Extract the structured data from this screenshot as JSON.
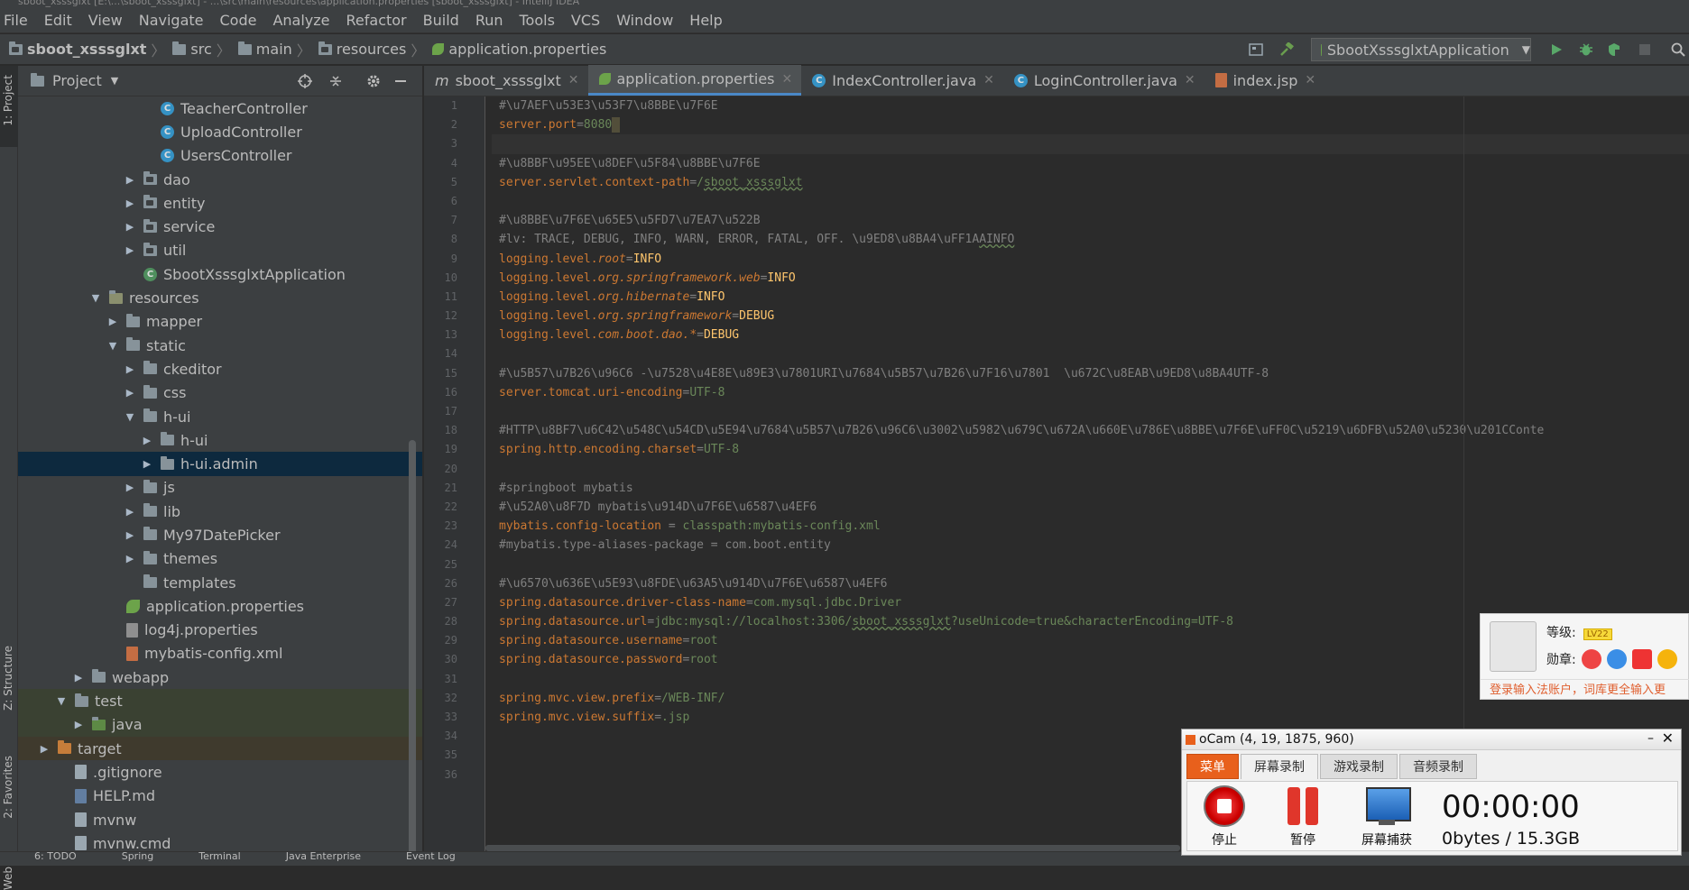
{
  "window_title": "sboot_xsssglxt [E:\\...\\sboot_xsssglxt] - ...\\src\\main\\resources\\application.properties [sboot_xsssglxt] - IntelliJ IDEA",
  "menu": [
    "File",
    "Edit",
    "View",
    "Navigate",
    "Code",
    "Analyze",
    "Refactor",
    "Build",
    "Run",
    "Tools",
    "VCS",
    "Window",
    "Help"
  ],
  "breadcrumb": [
    "sboot_xsssglxt",
    "src",
    "main",
    "resources",
    "application.properties"
  ],
  "run_config": "SbootXsssglxtApplication",
  "project_panel": {
    "title": "Project"
  },
  "left_strip": {
    "project": "1: Project",
    "structure": "Z: Structure",
    "favorites": "2: Favorites",
    "web": "Web"
  },
  "tree": [
    {
      "label": "TeacherController",
      "indent": 7,
      "icon": "class",
      "arrow": ""
    },
    {
      "label": "UploadController",
      "indent": 7,
      "icon": "class",
      "arrow": ""
    },
    {
      "label": "UsersController",
      "indent": 7,
      "icon": "class",
      "arrow": ""
    },
    {
      "label": "dao",
      "indent": 6,
      "icon": "package",
      "arrow": "▶"
    },
    {
      "label": "entity",
      "indent": 6,
      "icon": "package",
      "arrow": "▶"
    },
    {
      "label": "service",
      "indent": 6,
      "icon": "package",
      "arrow": "▶"
    },
    {
      "label": "util",
      "indent": 6,
      "icon": "package",
      "arrow": "▶"
    },
    {
      "label": "SbootXsssglxtApplication",
      "indent": 6,
      "icon": "spring-class",
      "arrow": ""
    },
    {
      "label": "resources",
      "indent": 4,
      "icon": "resources-folder",
      "arrow": "▼"
    },
    {
      "label": "mapper",
      "indent": 5,
      "icon": "folder",
      "arrow": "▶"
    },
    {
      "label": "static",
      "indent": 5,
      "icon": "folder",
      "arrow": "▼"
    },
    {
      "label": "ckeditor",
      "indent": 6,
      "icon": "folder",
      "arrow": "▶"
    },
    {
      "label": "css",
      "indent": 6,
      "icon": "folder",
      "arrow": "▶"
    },
    {
      "label": "h-ui",
      "indent": 6,
      "icon": "folder",
      "arrow": "▼"
    },
    {
      "label": "h-ui",
      "indent": 7,
      "icon": "folder",
      "arrow": "▶"
    },
    {
      "label": "h-ui.admin",
      "indent": 7,
      "icon": "folder",
      "arrow": "▶",
      "selected": true
    },
    {
      "label": "js",
      "indent": 6,
      "icon": "folder",
      "arrow": "▶"
    },
    {
      "label": "lib",
      "indent": 6,
      "icon": "folder",
      "arrow": "▶"
    },
    {
      "label": "My97DatePicker",
      "indent": 6,
      "icon": "folder",
      "arrow": "▶"
    },
    {
      "label": "themes",
      "indent": 6,
      "icon": "folder",
      "arrow": "▶"
    },
    {
      "label": "templates",
      "indent": 6,
      "icon": "folder",
      "arrow": ""
    },
    {
      "label": "application.properties",
      "indent": 5,
      "icon": "spring-properties",
      "arrow": ""
    },
    {
      "label": "log4j.properties",
      "indent": 5,
      "icon": "properties-file",
      "arrow": ""
    },
    {
      "label": "mybatis-config.xml",
      "indent": 5,
      "icon": "xml-file",
      "arrow": ""
    },
    {
      "label": "webapp",
      "indent": 3,
      "icon": "folder",
      "arrow": "▶"
    },
    {
      "label": "test",
      "indent": 2,
      "icon": "folder",
      "arrow": "▼",
      "bg": "test"
    },
    {
      "label": "java",
      "indent": 3,
      "icon": "test-folder",
      "arrow": "▶",
      "bg": "test"
    },
    {
      "label": "target",
      "indent": 1,
      "icon": "orange-folder",
      "arrow": "▶",
      "bg": "target"
    },
    {
      "label": ".gitignore",
      "indent": 2,
      "icon": "text-file",
      "arrow": ""
    },
    {
      "label": "HELP.md",
      "indent": 2,
      "icon": "md-file",
      "arrow": ""
    },
    {
      "label": "mvnw",
      "indent": 2,
      "icon": "text-file",
      "arrow": ""
    },
    {
      "label": "mvnw.cmd",
      "indent": 2,
      "icon": "text-file",
      "arrow": ""
    }
  ],
  "tabs": [
    {
      "label": "sboot_xsssglxt",
      "icon": "maven-icon",
      "active": false
    },
    {
      "label": "application.properties",
      "icon": "spring-properties-icon",
      "active": true
    },
    {
      "label": "IndexController.java",
      "icon": "class-icon",
      "active": false
    },
    {
      "label": "LoginController.java",
      "icon": "class-icon",
      "active": false
    },
    {
      "label": "index.jsp",
      "icon": "jsp-icon",
      "active": false
    }
  ],
  "code_lines": [
    [
      [
        "c",
        "#\\u7AEF\\u53E3\\u53F7\\u8BBE\\u7F6E"
      ]
    ],
    [
      [
        "k",
        "server.port"
      ],
      [
        "eq",
        "="
      ],
      [
        "v",
        "8080"
      ],
      [
        "caret",
        ""
      ]
    ],
    [],
    [
      [
        "c",
        "#\\u8BBF\\u95EE\\u8DEF\\u5F84\\u8BBE\\u7F6E"
      ]
    ],
    [
      [
        "k",
        "server.servlet.context-path"
      ],
      [
        "eq",
        "="
      ],
      [
        "v",
        "/"
      ],
      [
        "vu",
        "sboot_xsssglxt"
      ]
    ],
    [],
    [
      [
        "c",
        "#\\u8BBE\\u7F6E\\u65E5\\u5FD7\\u7EA7\\u522B"
      ]
    ],
    [
      [
        "c",
        "#lv: TRACE, DEBUG, INFO, WARN, ERROR, FATAL, OFF. \\u9ED8\\u8BA4\\uFF1A"
      ],
      [
        "cu",
        "AINFO"
      ]
    ],
    [
      [
        "k",
        "logging.level."
      ],
      [
        "ki",
        "root"
      ],
      [
        "eq",
        "="
      ],
      [
        "y",
        "INFO"
      ]
    ],
    [
      [
        "k",
        "logging.level."
      ],
      [
        "ki",
        "org.springframework.web"
      ],
      [
        "eq",
        "="
      ],
      [
        "y",
        "INFO"
      ]
    ],
    [
      [
        "k",
        "logging.level."
      ],
      [
        "ki",
        "org.hibernate"
      ],
      [
        "eq",
        "="
      ],
      [
        "y",
        "INFO"
      ]
    ],
    [
      [
        "k",
        "logging.level."
      ],
      [
        "ki",
        "org.springframework"
      ],
      [
        "eq",
        "="
      ],
      [
        "y",
        "DEBUG"
      ]
    ],
    [
      [
        "k",
        "logging.level."
      ],
      [
        "ki",
        "com.boot.dao.*"
      ],
      [
        "eq",
        "="
      ],
      [
        "y",
        "DEBUG"
      ]
    ],
    [],
    [
      [
        "c",
        "#\\u5B57\\u7B26\\u96C6 -\\u7528\\u4E8E\\u89E3\\u7801URI\\u7684\\u5B57\\u7B26\\u7F16\\u7801  \\u672C\\u8EAB\\u9ED8\\u8BA4UTF-8"
      ]
    ],
    [
      [
        "k",
        "server.tomcat.uri-encoding"
      ],
      [
        "eq",
        "="
      ],
      [
        "v",
        "UTF-8"
      ]
    ],
    [],
    [
      [
        "c",
        "#HTTP\\u8BF7\\u6C42\\u548C\\u54CD\\u5E94\\u7684\\u5B57\\u7B26\\u96C6\\u3002\\u5982\\u679C\\u672A\\u660E\\u786E\\u8BBE\\u7F6E\\uFF0C\\u5219\\u6DFB\\u52A0\\u5230\\u201CConte"
      ]
    ],
    [
      [
        "k",
        "spring.http.encoding.charset"
      ],
      [
        "eq",
        "="
      ],
      [
        "v",
        "UTF-8"
      ]
    ],
    [],
    [
      [
        "c",
        "#springboot mybatis"
      ]
    ],
    [
      [
        "c",
        "#\\u52A0\\u8F7D mybatis\\u914D\\u7F6E\\u6587\\u4EF6"
      ]
    ],
    [
      [
        "k",
        "mybatis.config-location"
      ],
      [
        "eq",
        " = "
      ],
      [
        "v",
        "classpath:mybatis-config.xml"
      ]
    ],
    [
      [
        "c",
        "#mybatis.type-aliases-package = com.boot.entity"
      ]
    ],
    [],
    [
      [
        "c",
        "#\\u6570\\u636E\\u5E93\\u8FDE\\u63A5\\u914D\\u7F6E\\u6587\\u4EF6"
      ]
    ],
    [
      [
        "k",
        "spring.datasource.driver-class-name"
      ],
      [
        "eq",
        "="
      ],
      [
        "v",
        "com.mysql.jdbc.Driver"
      ]
    ],
    [
      [
        "k",
        "spring.datasource.url"
      ],
      [
        "eq",
        "="
      ],
      [
        "v",
        "jdbc:mysql://localhost:3306/"
      ],
      [
        "vu",
        "sboot_xsssglxt"
      ],
      [
        "v",
        "?useUnicode=true&characterEncoding=UTF-8"
      ]
    ],
    [
      [
        "k",
        "spring.datasource.username"
      ],
      [
        "eq",
        "="
      ],
      [
        "v",
        "root"
      ]
    ],
    [
      [
        "k",
        "spring.datasource.password"
      ],
      [
        "eq",
        "="
      ],
      [
        "v",
        "root"
      ]
    ],
    [],
    [
      [
        "k",
        "spring.mvc.view.prefix"
      ],
      [
        "eq",
        "="
      ],
      [
        "v",
        "/WEB-INF/"
      ]
    ],
    [
      [
        "k",
        "spring.mvc.view.suffix"
      ],
      [
        "eq",
        "="
      ],
      [
        "v",
        ".jsp"
      ]
    ],
    [],
    [],
    []
  ],
  "current_line": 3,
  "popup": {
    "level_label": "等级:",
    "level_badge": "LV22",
    "medals_label": "勋章:",
    "footer": "登录输入法账户，词库更全输入更"
  },
  "ocam": {
    "title": "oCam (4, 19, 1875, 960)",
    "tabs": [
      "菜单",
      "屏幕录制",
      "游戏录制",
      "音频录制"
    ],
    "stop": "停止",
    "pause": "暂停",
    "capture": "屏幕捕获",
    "timer": "00:00:00",
    "size": "0bytes / 15.3GB"
  },
  "bottom_items": [
    "6: TODO",
    "Spring",
    "Terminal",
    "Java Enterprise",
    "Event Log"
  ]
}
